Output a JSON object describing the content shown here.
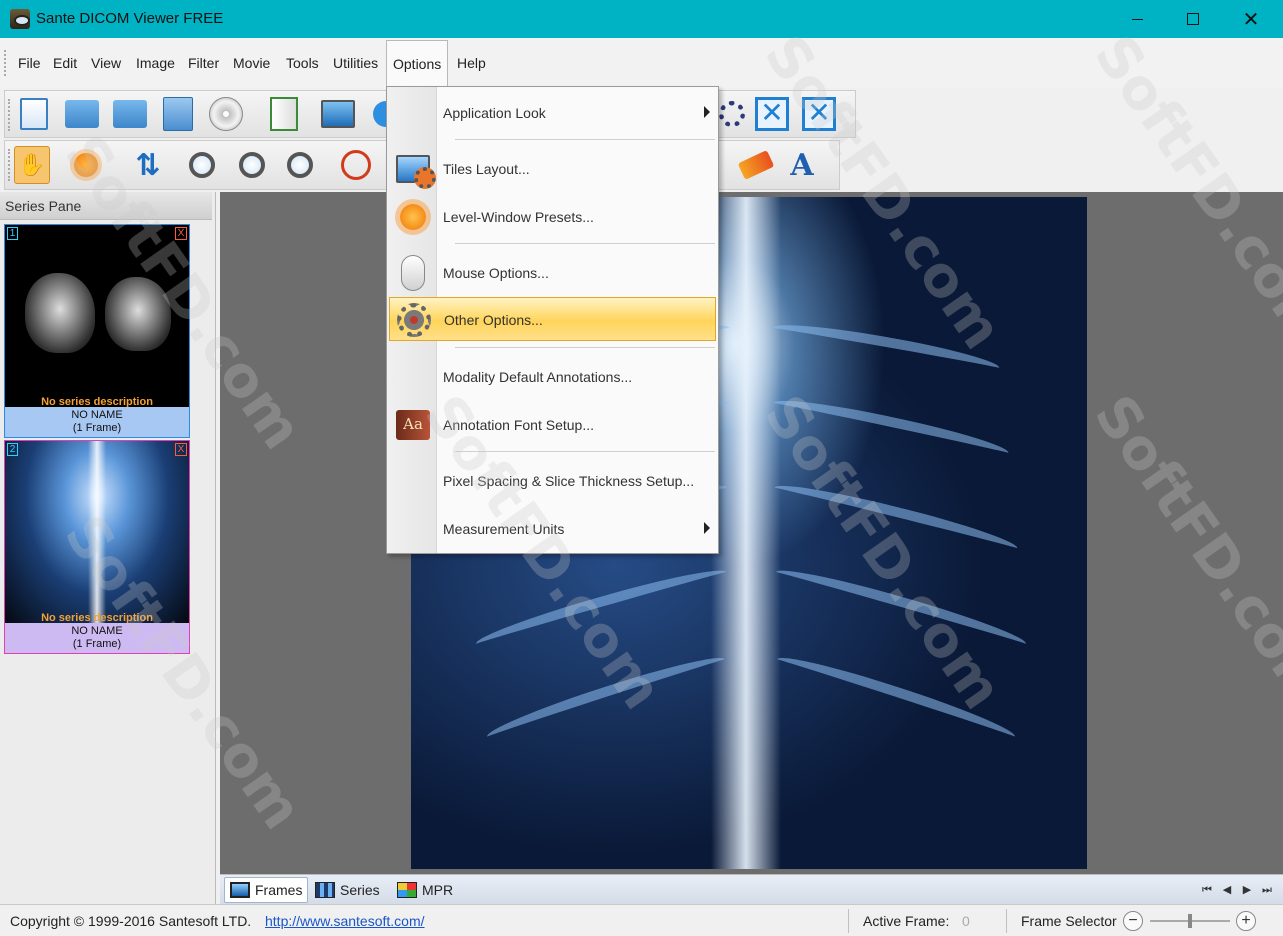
{
  "window": {
    "title": "Sante DICOM Viewer FREE",
    "controls": {
      "minimize": "minimize",
      "maximize": "maximize",
      "close": "✕"
    }
  },
  "menubar": {
    "items": [
      "File",
      "Edit",
      "View",
      "Image",
      "Filter",
      "Movie",
      "Tools",
      "Utilities",
      "Options",
      "Help"
    ],
    "active": "Options"
  },
  "options_menu": {
    "items": [
      {
        "label": "Application Look",
        "icon": "none",
        "submenu": true
      },
      {
        "label": "Tiles Layout...",
        "icon": "monitor-gear-icon",
        "submenu": false
      },
      {
        "label": "Level-Window Presets...",
        "icon": "sun-gear-icon",
        "submenu": false
      },
      {
        "label": "Mouse Options...",
        "icon": "mouse-icon",
        "submenu": false
      },
      {
        "label": "Other Options...",
        "icon": "gear-icon",
        "submenu": false,
        "highlighted": true
      },
      {
        "label": "Modality Default Annotations...",
        "icon": "none",
        "submenu": false
      },
      {
        "label": "Annotation Font Setup...",
        "icon": "font-book-icon",
        "icon_text": "Aa",
        "submenu": false
      },
      {
        "label": "Pixel Spacing & Slice Thickness Setup...",
        "icon": "none",
        "submenu": false
      },
      {
        "label": "Measurement Units",
        "icon": "none",
        "submenu": true
      }
    ]
  },
  "series_pane": {
    "title": "Series Pane",
    "series": [
      {
        "index": "1",
        "close": "X",
        "description": "No series description",
        "name": "NO NAME",
        "frames": "(1 Frame)",
        "thumbnail": "brain-mri"
      },
      {
        "index": "2",
        "close": "X",
        "description": "No series description",
        "name": "NO NAME",
        "frames": "(1 Frame)",
        "thumbnail": "chest-xray"
      }
    ]
  },
  "view_tabs": {
    "tabs": [
      {
        "label": "Frames",
        "icon": "frames-icon",
        "active": true
      },
      {
        "label": "Series",
        "icon": "series-icon",
        "active": false
      },
      {
        "label": "MPR",
        "icon": "mpr-icon",
        "active": false
      }
    ],
    "nav": [
      "⏮",
      "◀",
      "▶",
      "⏭"
    ]
  },
  "statusbar": {
    "copyright": "Copyright © 1999-2016 Santesoft LTD.",
    "link": "http://www.santesoft.com/",
    "active_frame_label": "Active Frame:",
    "active_frame_value": "0",
    "frame_selector_label": "Frame Selector",
    "zoom_out": "−",
    "zoom_in": "+"
  },
  "toolbar_icons": {
    "row1": [
      "open-file-icon",
      "open-folder-icon",
      "open-folders-icon",
      "dicomdir-icon",
      "cd-icon",
      "report-icon",
      "monitor-settings-icon",
      "info-icon",
      "gear-icon",
      "fit-window-icon",
      "fit-width-icon"
    ],
    "row2": [
      "pan-hand-icon",
      "window-level-icon",
      "scroll-icon",
      "zoom-icon",
      "magnify-icon",
      "zoom-inout-icon",
      "roi-circle-icon",
      "eraser-icon",
      "text-annotation-icon"
    ]
  },
  "colors": {
    "titlebar": "#00b3c4",
    "menu_highlight": "#ffd45a",
    "thumb1_border": "#2c8ae0",
    "thumb2_border": "#e040b0",
    "series_description": "#f3a236"
  },
  "watermark": "SoftFD.com"
}
